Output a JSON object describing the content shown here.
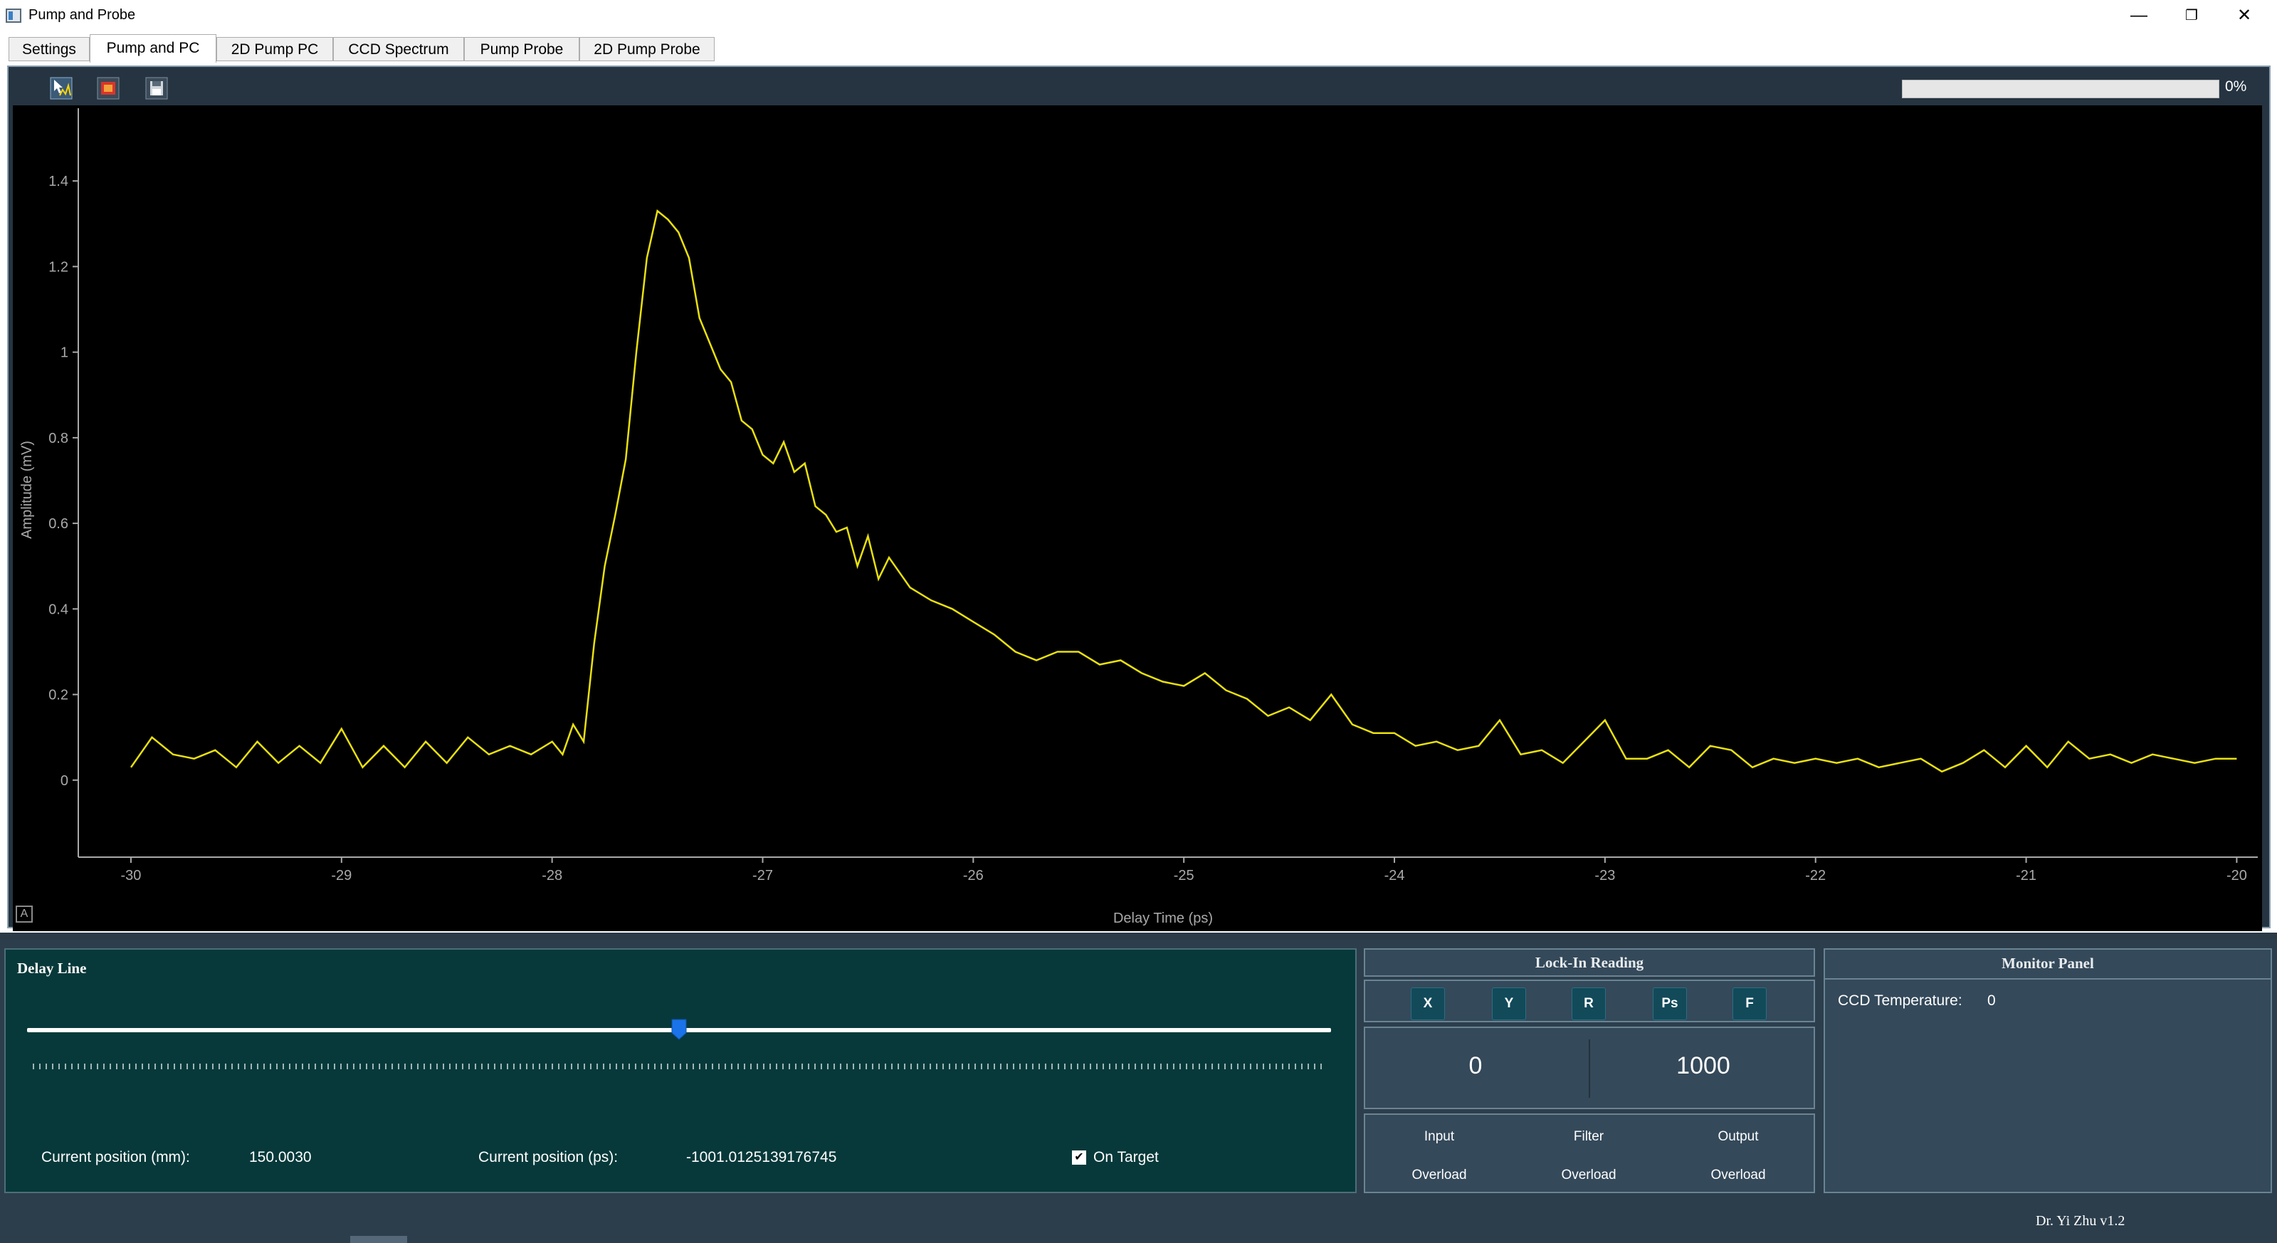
{
  "window": {
    "title": "Pump and Probe",
    "minimize": "—",
    "restore": "❐",
    "close": "✕"
  },
  "tabs": [
    {
      "label": "Settings"
    },
    {
      "label": "Pump and PC"
    },
    {
      "label": "2D Pump PC"
    },
    {
      "label": "CCD Spectrum"
    },
    {
      "label": "Pump Probe"
    },
    {
      "label": "2D Pump Probe"
    }
  ],
  "active_tab": "Pump and PC",
  "toolbar": {
    "icons": [
      "chart-cursor-icon",
      "stop-icon",
      "save-icon"
    ],
    "progress_text": "0%",
    "progress_value": 0
  },
  "chart_data": {
    "type": "line",
    "xlabel": "Delay Time (ps)",
    "ylabel": "Amplitude (mV)",
    "xlim": [
      -30.25,
      -19.9
    ],
    "ylim": [
      -0.18,
      1.57
    ],
    "xticks": [
      -30,
      -29,
      -28,
      -27,
      -26,
      -25,
      -24,
      -23,
      -22,
      -21,
      -20
    ],
    "yticks": [
      0,
      0.2,
      0.4,
      0.6,
      0.8,
      1,
      1.2,
      1.4
    ],
    "grid": false,
    "line_color": "#e8e010",
    "series": [
      {
        "x": [
          -30.0,
          -29.9,
          -29.8,
          -29.7,
          -29.6,
          -29.5,
          -29.4,
          -29.3,
          -29.2,
          -29.1,
          -29.0,
          -28.9,
          -28.8,
          -28.7,
          -28.6,
          -28.5,
          -28.4,
          -28.3,
          -28.2,
          -28.1,
          -28.0,
          -27.95,
          -27.9,
          -27.85,
          -27.8,
          -27.75,
          -27.7,
          -27.65,
          -27.6,
          -27.55,
          -27.5,
          -27.45,
          -27.4,
          -27.35,
          -27.3,
          -27.25,
          -27.2,
          -27.15,
          -27.1,
          -27.05,
          -27.0,
          -26.95,
          -26.9,
          -26.85,
          -26.8,
          -26.75,
          -26.7,
          -26.65,
          -26.6,
          -26.55,
          -26.5,
          -26.45,
          -26.4,
          -26.3,
          -26.2,
          -26.1,
          -26.0,
          -25.9,
          -25.8,
          -25.7,
          -25.6,
          -25.5,
          -25.4,
          -25.3,
          -25.2,
          -25.1,
          -25.0,
          -24.9,
          -24.8,
          -24.7,
          -24.6,
          -24.5,
          -24.4,
          -24.3,
          -24.2,
          -24.1,
          -24.0,
          -23.9,
          -23.8,
          -23.7,
          -23.6,
          -23.5,
          -23.4,
          -23.3,
          -23.2,
          -23.1,
          -23.0,
          -22.9,
          -22.8,
          -22.7,
          -22.6,
          -22.5,
          -22.4,
          -22.3,
          -22.2,
          -22.1,
          -22.0,
          -21.9,
          -21.8,
          -21.7,
          -21.6,
          -21.5,
          -21.4,
          -21.3,
          -21.2,
          -21.1,
          -21.0,
          -20.9,
          -20.8,
          -20.7,
          -20.6,
          -20.5,
          -20.4,
          -20.3,
          -20.2,
          -20.1,
          -20.0
        ],
        "y": [
          0.03,
          0.1,
          0.06,
          0.05,
          0.07,
          0.03,
          0.09,
          0.04,
          0.08,
          0.04,
          0.12,
          0.03,
          0.08,
          0.03,
          0.09,
          0.04,
          0.1,
          0.06,
          0.08,
          0.06,
          0.09,
          0.06,
          0.13,
          0.09,
          0.32,
          0.5,
          0.62,
          0.75,
          1.0,
          1.22,
          1.33,
          1.31,
          1.28,
          1.22,
          1.08,
          1.02,
          0.96,
          0.93,
          0.84,
          0.82,
          0.76,
          0.74,
          0.79,
          0.72,
          0.74,
          0.64,
          0.62,
          0.58,
          0.59,
          0.5,
          0.57,
          0.47,
          0.52,
          0.45,
          0.42,
          0.4,
          0.37,
          0.34,
          0.3,
          0.28,
          0.3,
          0.3,
          0.27,
          0.28,
          0.25,
          0.23,
          0.22,
          0.25,
          0.21,
          0.19,
          0.15,
          0.17,
          0.14,
          0.2,
          0.13,
          0.11,
          0.11,
          0.08,
          0.09,
          0.07,
          0.08,
          0.14,
          0.06,
          0.07,
          0.04,
          0.09,
          0.14,
          0.05,
          0.05,
          0.07,
          0.03,
          0.08,
          0.07,
          0.03,
          0.05,
          0.04,
          0.05,
          0.04,
          0.05,
          0.03,
          0.04,
          0.05,
          0.02,
          0.04,
          0.07,
          0.03,
          0.08,
          0.03,
          0.09,
          0.05,
          0.06,
          0.04,
          0.06,
          0.05,
          0.04,
          0.05,
          0.05
        ]
      }
    ]
  },
  "delay_line": {
    "title": "Delay Line",
    "slider_fraction": 0.5,
    "pos_mm_label": "Current position (mm):",
    "pos_mm_value": "150.0030",
    "pos_ps_label": "Current position (ps):",
    "pos_ps_value": "-1001.0125139176745",
    "on_target_label": "On Target",
    "on_target_checked": true
  },
  "lockin": {
    "title": "Lock-In Reading",
    "buttons": [
      "X",
      "Y",
      "R",
      "Ps",
      "F"
    ],
    "value_left": "0",
    "value_right": "1000",
    "overload": [
      {
        "name": "Input",
        "status": "Overload"
      },
      {
        "name": "Filter",
        "status": "Overload"
      },
      {
        "name": "Output",
        "status": "Overload"
      }
    ]
  },
  "monitor": {
    "title": "Monitor Panel",
    "ccd_label": "CCD Temperature:",
    "ccd_value": "0"
  },
  "footer": {
    "credit": "Dr. Yi Zhu v1.2"
  }
}
